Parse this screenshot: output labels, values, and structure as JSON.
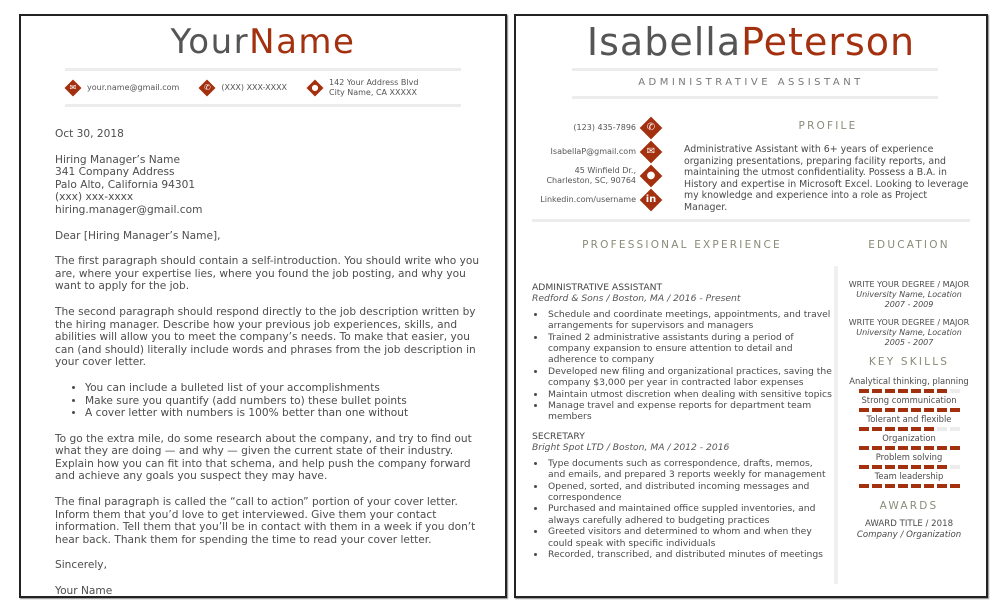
{
  "cover_letter": {
    "name_first": "Your",
    "name_last": "Name",
    "contacts": [
      {
        "icon": "envelope-icon",
        "glyph": "✉",
        "lines": [
          "your.name@gmail.com"
        ]
      },
      {
        "icon": "phone-icon",
        "glyph": "✆",
        "lines": [
          "(XXX) XXX-XXXX"
        ]
      },
      {
        "icon": "location-pin-icon",
        "glyph": "●",
        "lines": [
          "142 Your Address Blvd",
          "City Name, CA XXXXX"
        ]
      }
    ],
    "date": "Oct 30, 2018",
    "recipient": [
      "Hiring Manager’s Name",
      "341 Company Address",
      "Palo Alto, California 94301",
      "(xxx) xxx-xxxx",
      "hiring.manager@gmail.com"
    ],
    "salutation": "Dear [Hiring Manager’s Name],",
    "paragraph_1": "The first paragraph should contain a self-introduction. You should write who you are, where your expertise lies, where you found the job posting, and why you want to apply for the job.",
    "paragraph_2": "The second paragraph should respond directly to the job description written by the hiring manager. Describe how your previous job experiences, skills, and abilities will allow you to meet the company’s needs. To make that easier, you can (and should) literally include words and phrases from the job description in your cover letter.",
    "bullets": [
      "You can include a bulleted list of your accomplishments",
      "Make sure you quantify (add numbers to) these bullet points",
      "A cover letter with numbers is 100% better than one without"
    ],
    "paragraph_3": "To go the extra mile, do some research about the company, and try to find out what they are doing — and why — given the current state of their industry. Explain how you can fit into that schema, and help push the company forward and achieve any goals you suspect they may have.",
    "paragraph_4": "The final paragraph is called the “call to action” portion of your cover letter. Inform them that you’d love to get interviewed. Give them your contact information. Tell them that you’ll be in contact with them in a week if you don’t hear back. Thank them for spending the time to read your cover letter.",
    "closing": "Sincerely,",
    "signature": "Your Name"
  },
  "resume": {
    "name_first": "Isabella",
    "name_last": "Peterson",
    "job_title": "ADMINISTRATIVE ASSISTANT",
    "contacts": [
      {
        "icon": "phone-icon",
        "glyph": "✆",
        "lines": [
          "(123) 435-7896"
        ]
      },
      {
        "icon": "envelope-icon",
        "glyph": "✉",
        "lines": [
          "IsabellaP@gmail.com"
        ]
      },
      {
        "icon": "location-pin-icon",
        "glyph": "●",
        "lines": [
          "45 Winfield Dr.,",
          "Charleston, SC, 90764"
        ]
      },
      {
        "icon": "linkedin-icon",
        "glyph": "in",
        "lines": [
          "Linkedin.com/username"
        ]
      }
    ],
    "profile_heading": "PROFILE",
    "profile_text": "Administrative Assistant with 6+ years of experience organizing presentations, preparing facility reports, and maintaining the utmost confidentiality. Possess a B.A. in History and expertise in Microsoft Excel. Looking to leverage my knowledge and experience into a role as Project Manager.",
    "experience_heading": "PROFESSIONAL EXPERIENCE",
    "jobs": [
      {
        "title": "ADMINISTRATIVE ASSISTANT",
        "subtitle": "Redford & Sons / Boston, MA / 2016 - Present",
        "bullets": [
          "Schedule and coordinate meetings, appointments, and travel arrangements for supervisors and managers",
          "Trained 2 administrative assistants during a period of company expansion to ensure attention to detail and adherence to company",
          "Developed new filing and organizational practices, saving the company $3,000 per year in contracted labor expenses",
          "Maintain utmost discretion when dealing with sensitive topics",
          "Manage travel and expense reports for department team members"
        ]
      },
      {
        "title": "SECRETARY",
        "subtitle": "Bright Spot LTD / Boston, MA / 2012 - 2016",
        "bullets": [
          "Type documents such as correspondence, drafts, memos, and emails, and prepared 3 reports weekly for management",
          "Opened, sorted, and distributed incoming messages and correspondence",
          "Purchased and maintained office suppled inventories, and always carefully adhered to budgeting practices",
          "Greeted visitors and determined to whom and when they could speak with specific individuals",
          "Recorded, transcribed, and distributed minutes of meetings"
        ]
      }
    ],
    "education_heading": "EDUCATION",
    "education": [
      {
        "degree": "WRITE YOUR DEGREE / MAJOR",
        "school": "University Name, Location",
        "years": "2007 - 2009"
      },
      {
        "degree": "WRITE YOUR DEGREE / MAJOR",
        "school": "University Name, Location",
        "years": "2005 - 2007"
      }
    ],
    "skills_heading": "KEY SKILLS",
    "skills_scale_max": 8,
    "skills": [
      {
        "label": "Analytical thinking, planning",
        "rating": 7
      },
      {
        "label": "Strong communication",
        "rating": 8
      },
      {
        "label": "Tolerant and flexible",
        "rating": 6
      },
      {
        "label": "Organization",
        "rating": 8
      },
      {
        "label": "Problem solving",
        "rating": 7
      },
      {
        "label": "Team leadership",
        "rating": 8
      }
    ],
    "awards_heading": "AWARDS",
    "award_title": "AWARD TITLE / 2018",
    "award_org": "Company / Organization"
  },
  "colors": {
    "accent": "#a3300f",
    "name_gray": "#555555",
    "heading_gray": "#8a8a78",
    "rule": "#ececec"
  }
}
